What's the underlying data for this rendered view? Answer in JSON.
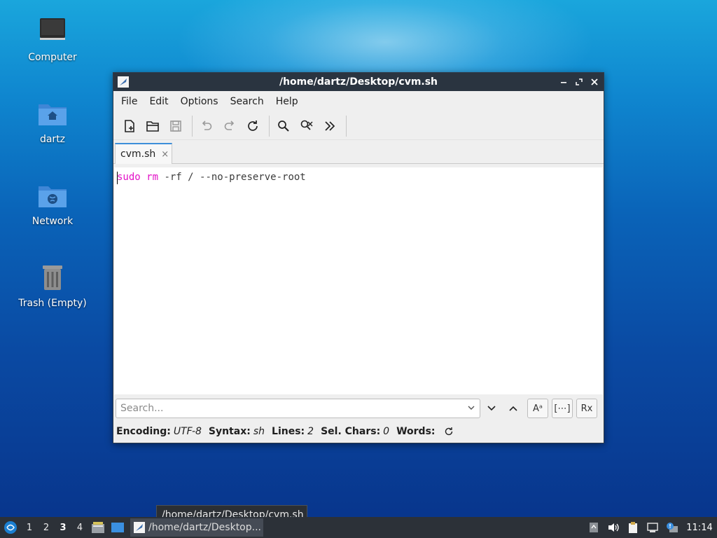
{
  "desktop": {
    "icons": [
      {
        "label": "Computer"
      },
      {
        "label": "dartz"
      },
      {
        "label": "Network"
      },
      {
        "label": "Trash (Empty)"
      }
    ]
  },
  "window": {
    "title": "/home/dartz/Desktop/cvm.sh",
    "controls": {
      "minimize": "minimize-icon",
      "maximize": "maximize-icon",
      "close": "close-icon"
    },
    "menu": [
      "File",
      "Edit",
      "Options",
      "Search",
      "Help"
    ],
    "toolbar": [
      "new-document-icon",
      "open-folder-icon",
      "save-icon",
      "undo-icon",
      "redo-icon",
      "reload-icon",
      "find-icon",
      "find-replace-icon",
      "more-icon"
    ],
    "tab": {
      "label": "cvm.sh",
      "close": "×"
    },
    "editor": {
      "tokens": [
        {
          "text": "sudo",
          "kind": "keyword"
        },
        {
          "text": " ",
          "kind": "plain"
        },
        {
          "text": "rm",
          "kind": "keyword"
        },
        {
          "text": " -rf / --no-preserve-root",
          "kind": "plain"
        }
      ]
    },
    "search": {
      "placeholder": "Search...",
      "options": [
        "Aᵃ",
        "[⋯]",
        "Rx"
      ]
    },
    "status": {
      "encoding_label": "Encoding:",
      "encoding_value": "UTF-8",
      "syntax_label": "Syntax:",
      "syntax_value": "sh",
      "lines_label": "Lines:",
      "lines_value": "2",
      "selchars_label": "Sel. Chars:",
      "selchars_value": "0",
      "words_label": "Words:"
    }
  },
  "tooltip": {
    "text": "/home/dartz/Desktop/cvm.sh"
  },
  "taskbar": {
    "workspaces": [
      "1",
      "2",
      "3",
      "4"
    ],
    "active_workspace": "3",
    "task_label": "/home/dartz/Desktop...",
    "clock": "11:14"
  },
  "colors": {
    "keyword": "#e312c7",
    "titlebar": "#2a3440",
    "taskbar": "#2c3138",
    "accent": "#3d8fd9"
  }
}
